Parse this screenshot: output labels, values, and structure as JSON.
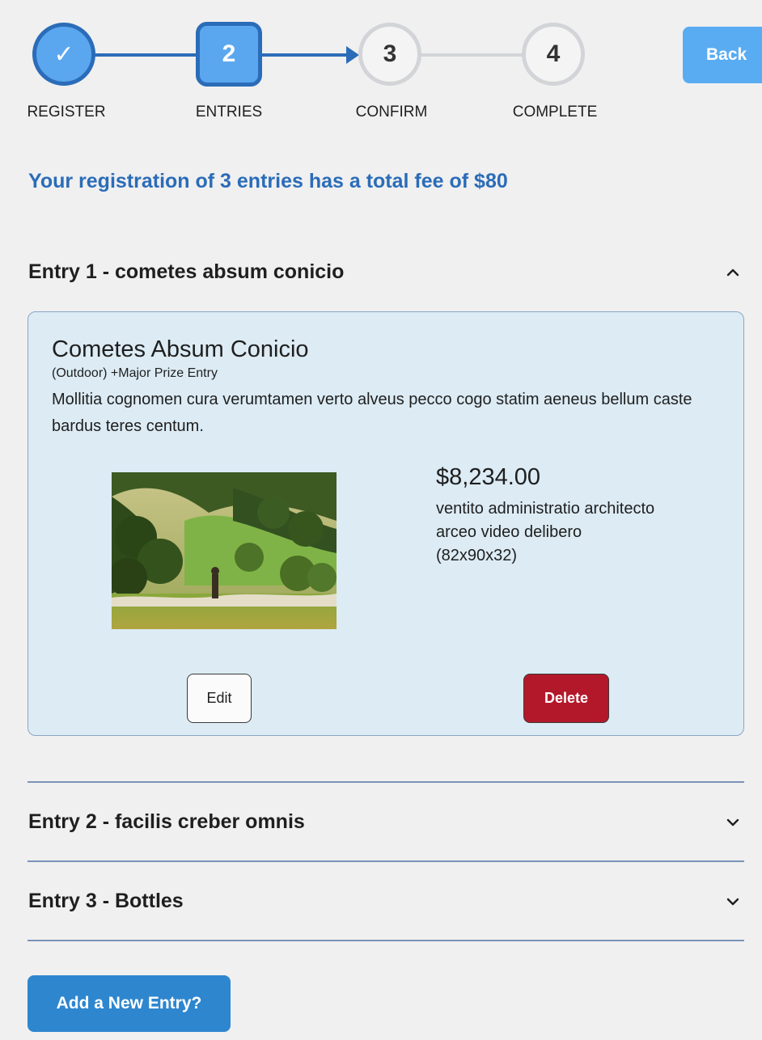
{
  "stepper": {
    "steps": [
      {
        "label": "REGISTER",
        "symbol": "✓",
        "state": "done"
      },
      {
        "label": "ENTRIES",
        "symbol": "2",
        "state": "current"
      },
      {
        "label": "CONFIRM",
        "symbol": "3",
        "state": "todo"
      },
      {
        "label": "COMPLETE",
        "symbol": "4",
        "state": "todo"
      }
    ],
    "back_label": "Back"
  },
  "summary": "Your registration of 3 entries has a total fee of $80",
  "entries": [
    {
      "heading": "Entry 1 - cometes absum conicio",
      "expanded": true,
      "chevron_icon": "chevron-up-icon",
      "card": {
        "title": "Cometes Absum Conicio",
        "subtitle": "(Outdoor) +Major Prize Entry",
        "description": "Mollitia cognomen cura verumtamen verto alveus pecco cogo statim aeneus bellum caste bardus teres centum.",
        "image_icon": "landscape-photo",
        "price": "$8,234.00",
        "specs": [
          "ventito administratio architecto",
          "arceo video delibero",
          "(82x90x32)"
        ],
        "edit_label": "Edit",
        "delete_label": "Delete"
      }
    },
    {
      "heading": "Entry 2 - facilis creber omnis",
      "expanded": false,
      "chevron_icon": "chevron-down-icon"
    },
    {
      "heading": "Entry 3 - Bottles",
      "expanded": false,
      "chevron_icon": "chevron-down-icon"
    }
  ],
  "add_entry_label": "Add a New Entry?",
  "colors": {
    "primary": "#2b6cb8",
    "step_fill": "#5aa7ef",
    "inactive": "#d2d4d8",
    "card_bg": "#dcebf4",
    "delete": "#b3182a",
    "add_button": "#2e86cf"
  }
}
